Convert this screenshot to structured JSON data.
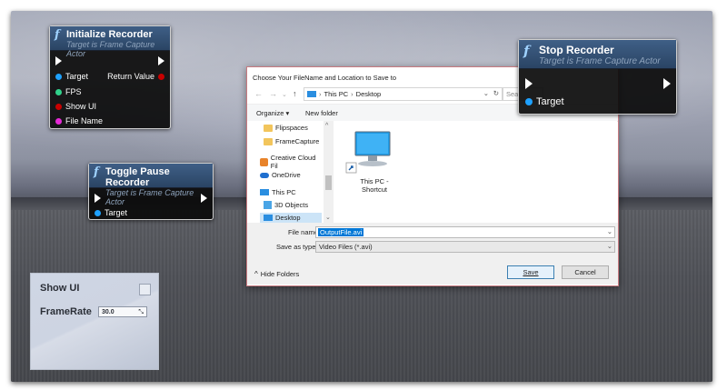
{
  "nodes": {
    "init": {
      "title": "Initialize Recorder",
      "subtitle": "Target is Frame Capture Actor",
      "pins": [
        "Target",
        "FPS",
        "Show UI",
        "File Name"
      ],
      "return_label": "Return Value"
    },
    "toggle": {
      "title": "Toggle Pause Recorder",
      "subtitle": "Target is Frame Capture Actor",
      "pins": [
        "Target"
      ]
    },
    "stop": {
      "title": "Stop Recorder",
      "subtitle": "Target is Frame Capture Actor",
      "pins": [
        "Target"
      ]
    },
    "function_glyph": "f",
    "colors": {
      "target_pin": "#1ea1ff",
      "fps_pin": "#31d28b",
      "showui_pin": "#c80000",
      "filename_pin": "#e62ad7",
      "return_pin": "#c80000"
    }
  },
  "dialog": {
    "title": "Choose Your FileName and Location to Save to",
    "breadcrumb": [
      "This PC",
      "Desktop"
    ],
    "breadcrumb_sep": "›",
    "search_placeholder": "Sea",
    "toolbar": {
      "organize": "Organize ▾",
      "new_folder": "New folder"
    },
    "tree": [
      {
        "label": "Flipspaces",
        "icon": "folder-icon"
      },
      {
        "label": "FrameCapture",
        "icon": "folder-icon"
      },
      {
        "label": "Creative Cloud Fil",
        "icon": "creative-cloud-icon"
      },
      {
        "label": "OneDrive",
        "icon": "cloud-icon"
      },
      {
        "label": "This PC",
        "icon": "computer-icon"
      },
      {
        "label": "3D Objects",
        "icon": "cube-icon"
      },
      {
        "label": "Desktop",
        "icon": "desktop-icon"
      }
    ],
    "file_item": {
      "line1": "This PC -",
      "line2": "Shortcut"
    },
    "file_name_label": "File name:",
    "file_name_value": "OutputFile.avi",
    "save_as_label": "Save as type:",
    "save_as_value": "Video Files (*.avi)",
    "hide_folders": "Hide Folders",
    "save_button": "Save",
    "cancel_button": "Cancel"
  },
  "panel": {
    "show_ui_label": "Show UI",
    "framerate_label": "FrameRate",
    "framerate_value": "30.0"
  }
}
